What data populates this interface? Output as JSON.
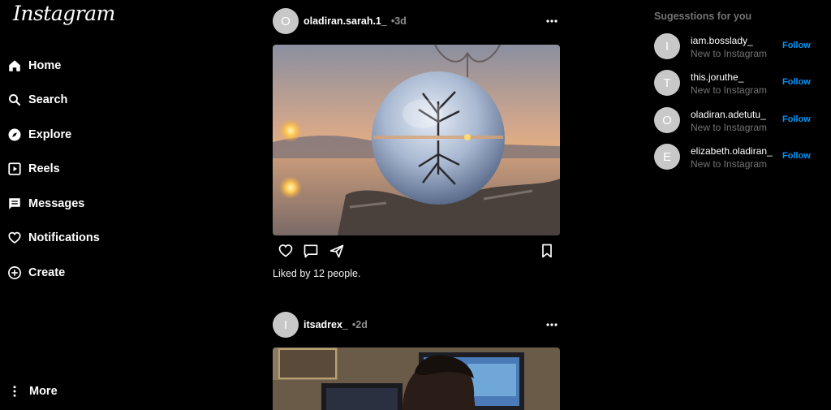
{
  "app": {
    "logo": "Instagram"
  },
  "sidebar": {
    "items": [
      {
        "label": "Home",
        "icon": "home-icon"
      },
      {
        "label": "Search",
        "icon": "search-icon"
      },
      {
        "label": "Explore",
        "icon": "compass-icon"
      },
      {
        "label": "Reels",
        "icon": "reels-icon"
      },
      {
        "label": "Messages",
        "icon": "message-icon"
      },
      {
        "label": "Notifications",
        "icon": "heart-icon"
      },
      {
        "label": "Create",
        "icon": "plus-circle-icon"
      }
    ],
    "more": {
      "label": "More",
      "icon": "more-vertical-icon"
    }
  },
  "feed": {
    "posts": [
      {
        "avatar_letter": "O",
        "username": "oladiran.sarah.1_",
        "age": "•3d",
        "likes": "Liked by 12 people."
      },
      {
        "avatar_letter": "I",
        "username": "itsadrex_",
        "age": "•2d"
      }
    ]
  },
  "suggestions": {
    "title": "Sugesstions for you",
    "follow_label": "Follow",
    "users": [
      {
        "letter": "I",
        "name": "iam.bosslady_",
        "subtitle": "New to Instagram"
      },
      {
        "letter": "T",
        "name": "this.joruthe_",
        "subtitle": "New to Instagram"
      },
      {
        "letter": "O",
        "name": "oladiran.adetutu_",
        "subtitle": "New to Instagram"
      },
      {
        "letter": "E",
        "name": "elizabeth.oladiran_",
        "subtitle": "New to Instagram"
      }
    ]
  },
  "colors": {
    "background": "#000000",
    "link": "#0095f6",
    "muted": "#737373",
    "avatar": "#c8c8c8"
  }
}
